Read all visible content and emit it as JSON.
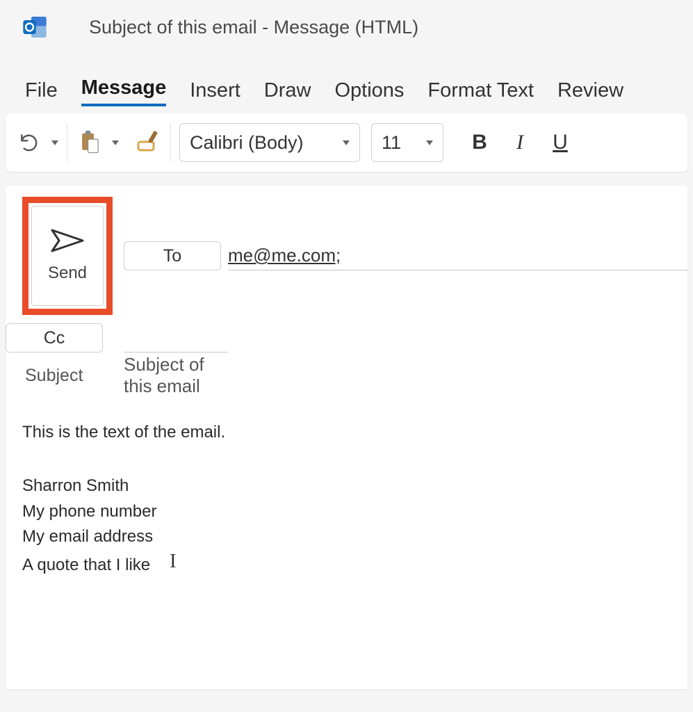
{
  "titlebar": {
    "title": "Subject of this email  -  Message (HTML)"
  },
  "menubar": {
    "items": [
      "File",
      "Message",
      "Insert",
      "Draw",
      "Options",
      "Format Text",
      "Review"
    ],
    "active_index": 1
  },
  "ribbon": {
    "font_name": "Calibri (Body)",
    "font_size": "11",
    "bold_glyph": "B",
    "italic_glyph": "I",
    "underline_glyph": "U"
  },
  "compose": {
    "send_label": "Send",
    "to_button_label": "To",
    "cc_button_label": "Cc",
    "subject_label": "Subject",
    "to_value": "me@me.com;",
    "cc_value": "",
    "subject_value": "Subject of this email"
  },
  "body": {
    "line1": "This is the text of the email.",
    "sig1": "Sharron Smith",
    "sig2": "My phone number",
    "sig3": "My email address",
    "sig4": "A quote that I like"
  }
}
